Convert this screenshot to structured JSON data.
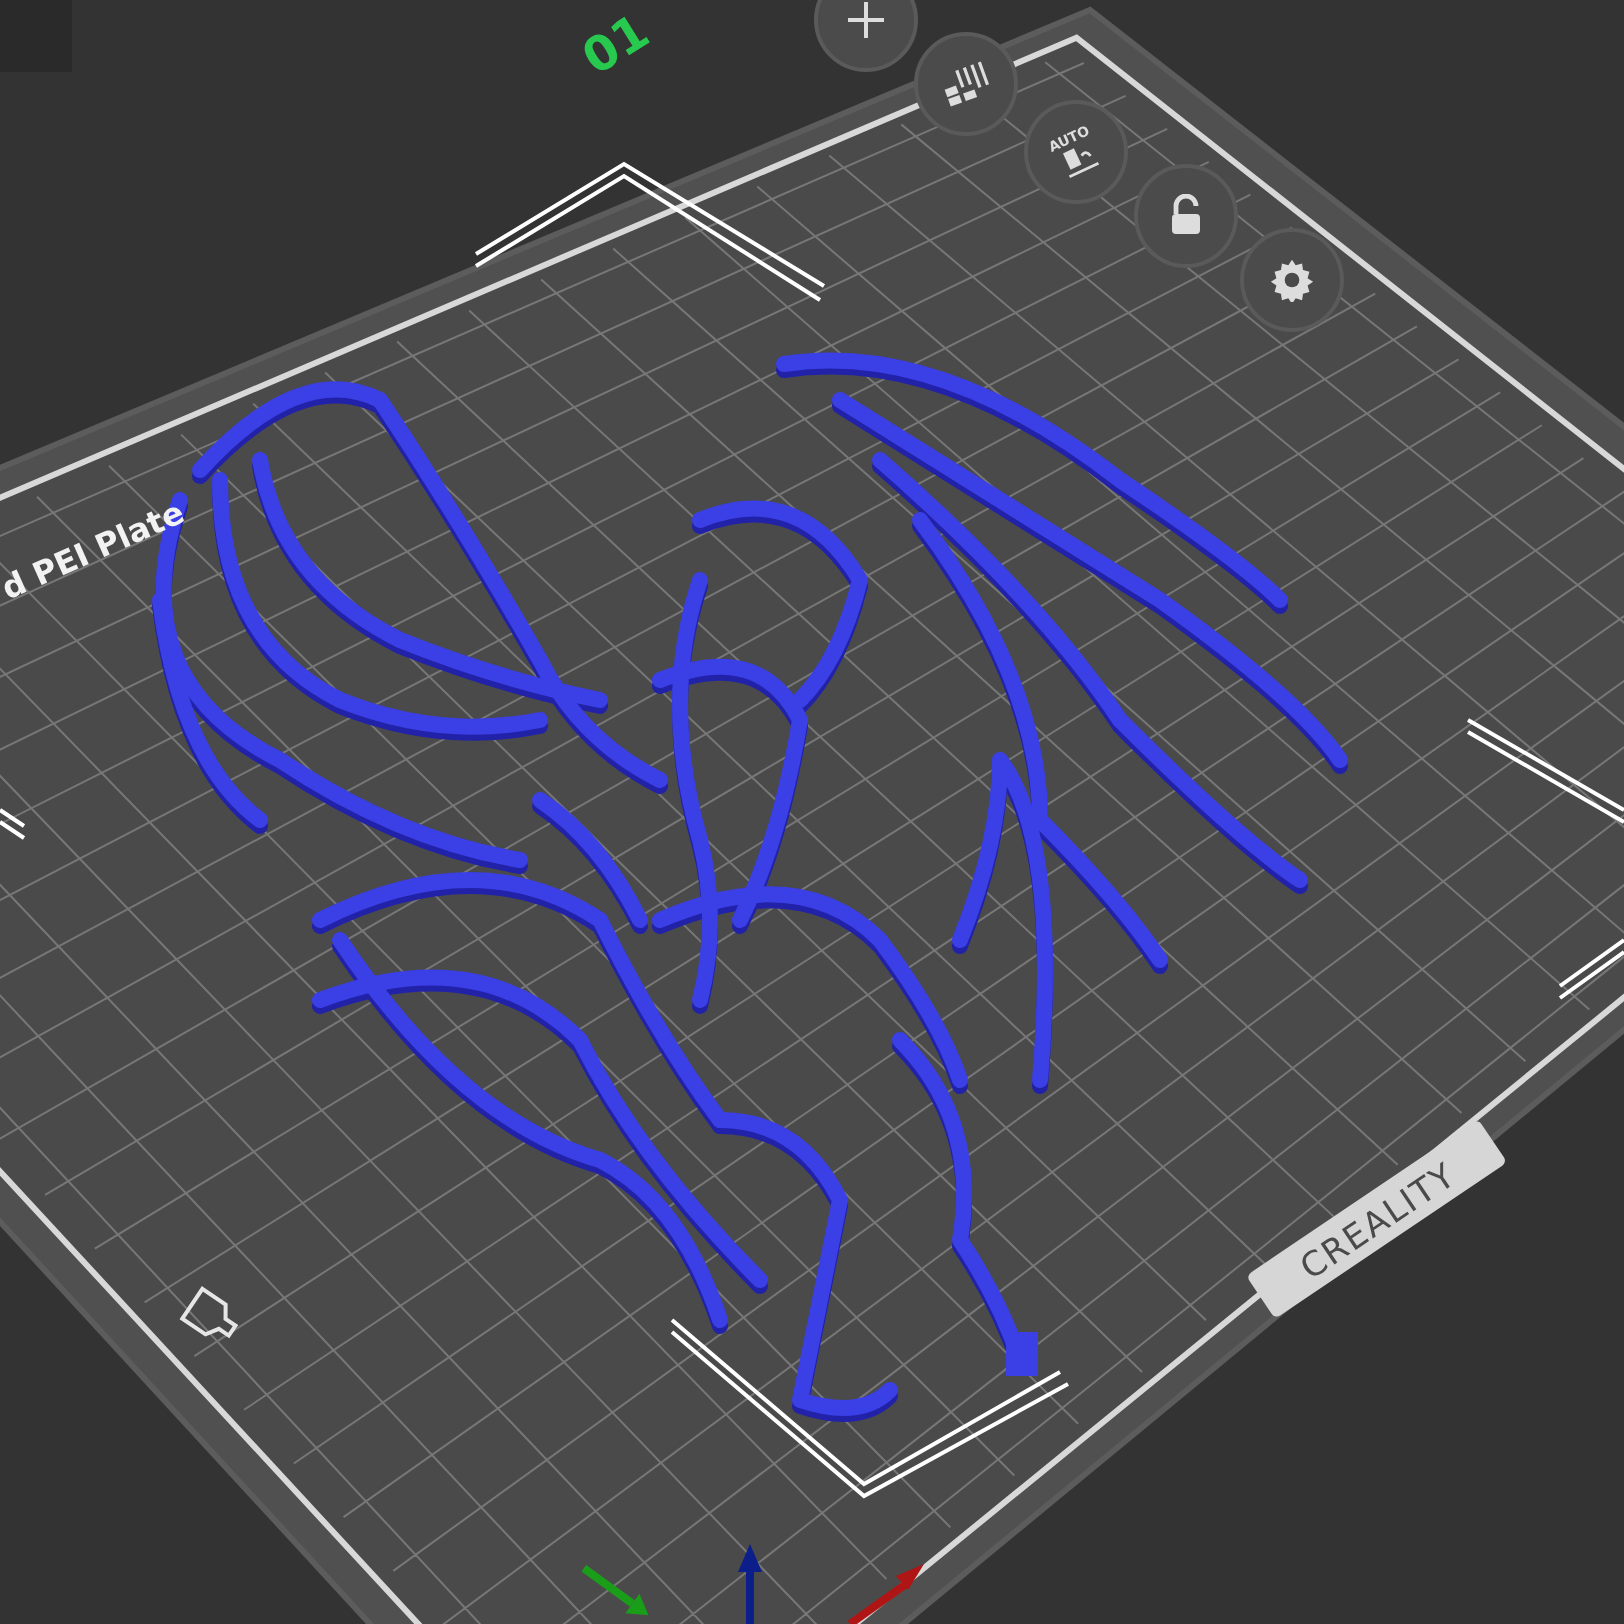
{
  "plate": {
    "number": "01",
    "label": "d PEI Plate",
    "brand": "CREALITY"
  },
  "toolbar": [
    {
      "kind": "add"
    },
    {
      "kind": "arrange"
    },
    {
      "kind": "auto",
      "label": "AUTO"
    },
    {
      "kind": "lock"
    },
    {
      "kind": "settings"
    }
  ]
}
